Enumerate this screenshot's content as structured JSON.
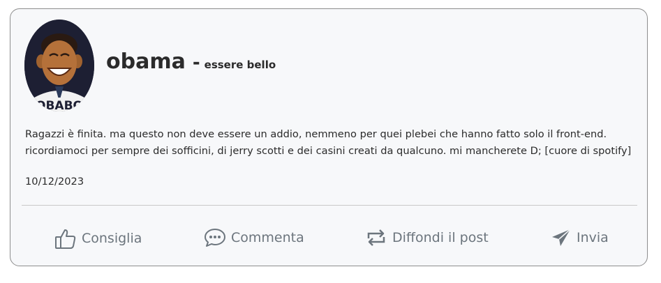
{
  "post": {
    "author": "obama",
    "separator": "-",
    "subtitle": "essere bello",
    "avatar_caption": "OBABO",
    "text": "Ragazzi è finita. ma questo non deve essere un addio, nemmeno per quei plebei che hanno fatto solo il front-end. ricordiamoci per sempre dei sofficini, di jerry scotti e dei casini creati da qualcuno. mi mancherete D; [cuore di spotify]",
    "date": "10/12/2023"
  },
  "actions": {
    "like": {
      "label": "Consiglia",
      "icon": "thumbs-up-icon"
    },
    "comment": {
      "label": "Commenta",
      "icon": "comment-dots-icon"
    },
    "share": {
      "label": "Diffondi il post",
      "icon": "repost-icon"
    },
    "send": {
      "label": "Invia",
      "icon": "paper-plane-icon"
    }
  },
  "colors": {
    "card_bg": "#f7f8fa",
    "card_border": "#8d8d8d",
    "action_text": "#6c757d",
    "avatar_bg": "#1d1f33"
  }
}
